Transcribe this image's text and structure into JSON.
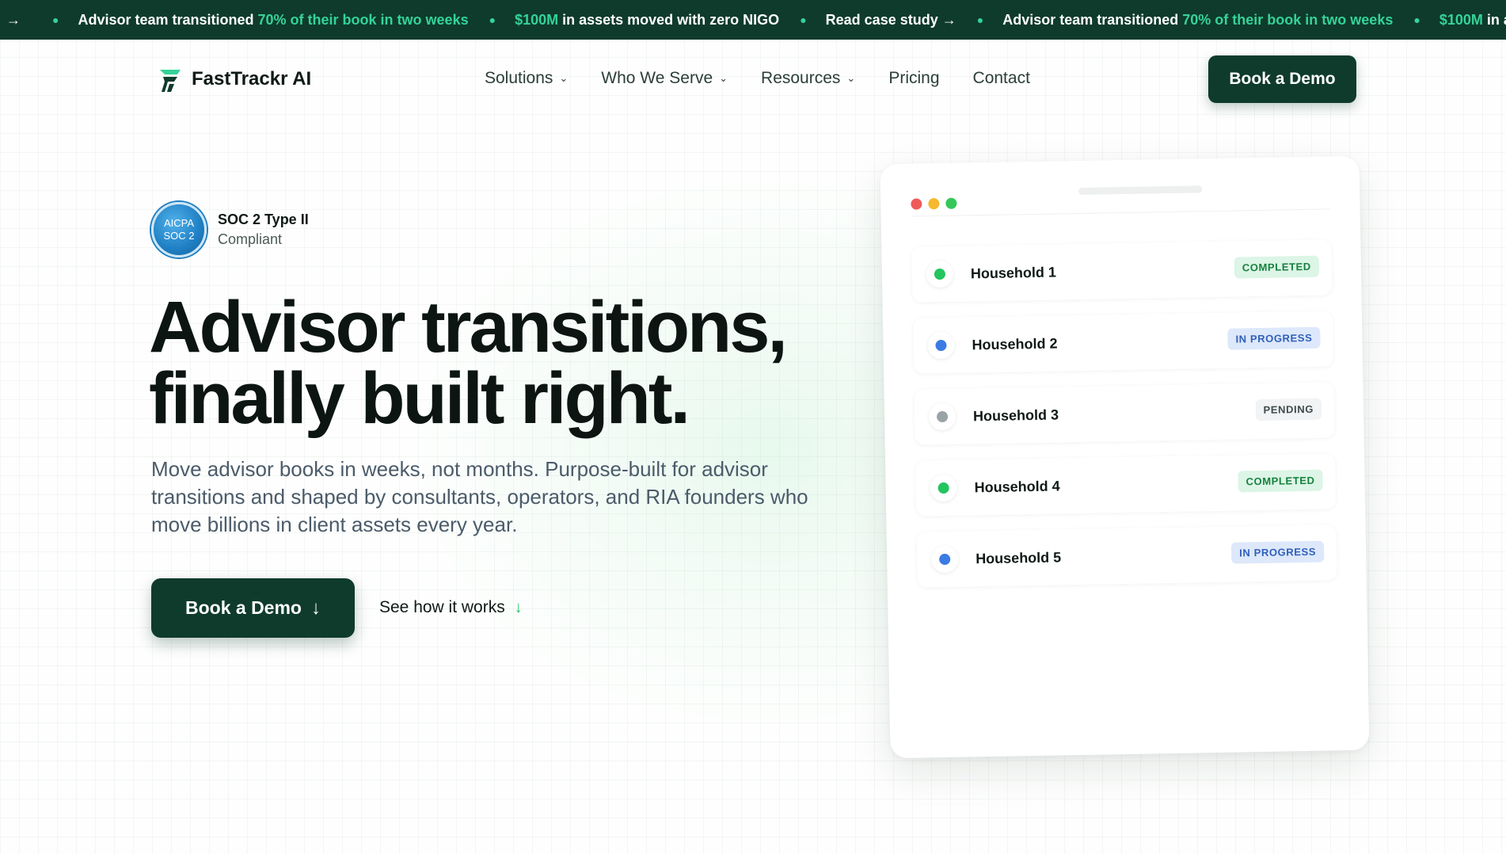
{
  "colors": {
    "brand_dark": "#0f3b2c",
    "accent_green": "#34d399",
    "completed": "#22c55e",
    "in_progress": "#3b7be4",
    "pending": "#9aa3a6"
  },
  "ticker": {
    "lead_icon": "arrow-right-icon",
    "items": [
      {
        "pre": "Advisor team transitioned ",
        "hl": "70% of their book in two weeks",
        "post": ""
      },
      {
        "pre": "",
        "hl": "$100M",
        "post": " in assets moved with zero NIGO"
      },
      {
        "link": "Read case study",
        "icon": "arrow-right-icon"
      },
      {
        "pre": "Advisor team transitioned ",
        "hl": "70% of their book in two weeks",
        "post": ""
      },
      {
        "pre": "",
        "hl": "$100M",
        "post": " in ass"
      }
    ]
  },
  "nav": {
    "logo_text": "FastTrackr AI",
    "links": [
      {
        "label": "Solutions",
        "has_dropdown": true
      },
      {
        "label": "Who We Serve",
        "has_dropdown": true
      },
      {
        "label": "Resources",
        "has_dropdown": true
      },
      {
        "label": "Pricing",
        "has_dropdown": false
      },
      {
        "label": "Contact",
        "has_dropdown": false
      }
    ],
    "cta_label": "Book a Demo"
  },
  "badge": {
    "seal_line1": "AICPA",
    "seal_line2": "SOC 2",
    "title": "SOC 2 Type II",
    "subtitle": "Compliant"
  },
  "hero": {
    "headline_line1": "Advisor transitions,",
    "headline_line2": "finally built right.",
    "subheadline": "Move advisor books in weeks, not months. Purpose-built for advisor transitions and shaped by consultants, operators, and RIA founders who move billions in client assets every year.",
    "cta_label": "Book a Demo",
    "secondary_label": "See how it works"
  },
  "mock": {
    "window_dots": [
      "#ef5b5b",
      "#f5b82e",
      "#34c759"
    ],
    "rows": [
      {
        "name": "Household 1",
        "status": "COMPLETED",
        "kind": "completed"
      },
      {
        "name": "Household 2",
        "status": "IN PROGRESS",
        "kind": "progress"
      },
      {
        "name": "Household 3",
        "status": "PENDING",
        "kind": "pending"
      },
      {
        "name": "Household 4",
        "status": "COMPLETED",
        "kind": "completed"
      },
      {
        "name": "Household 5",
        "status": "IN PROGRESS",
        "kind": "progress"
      }
    ]
  }
}
